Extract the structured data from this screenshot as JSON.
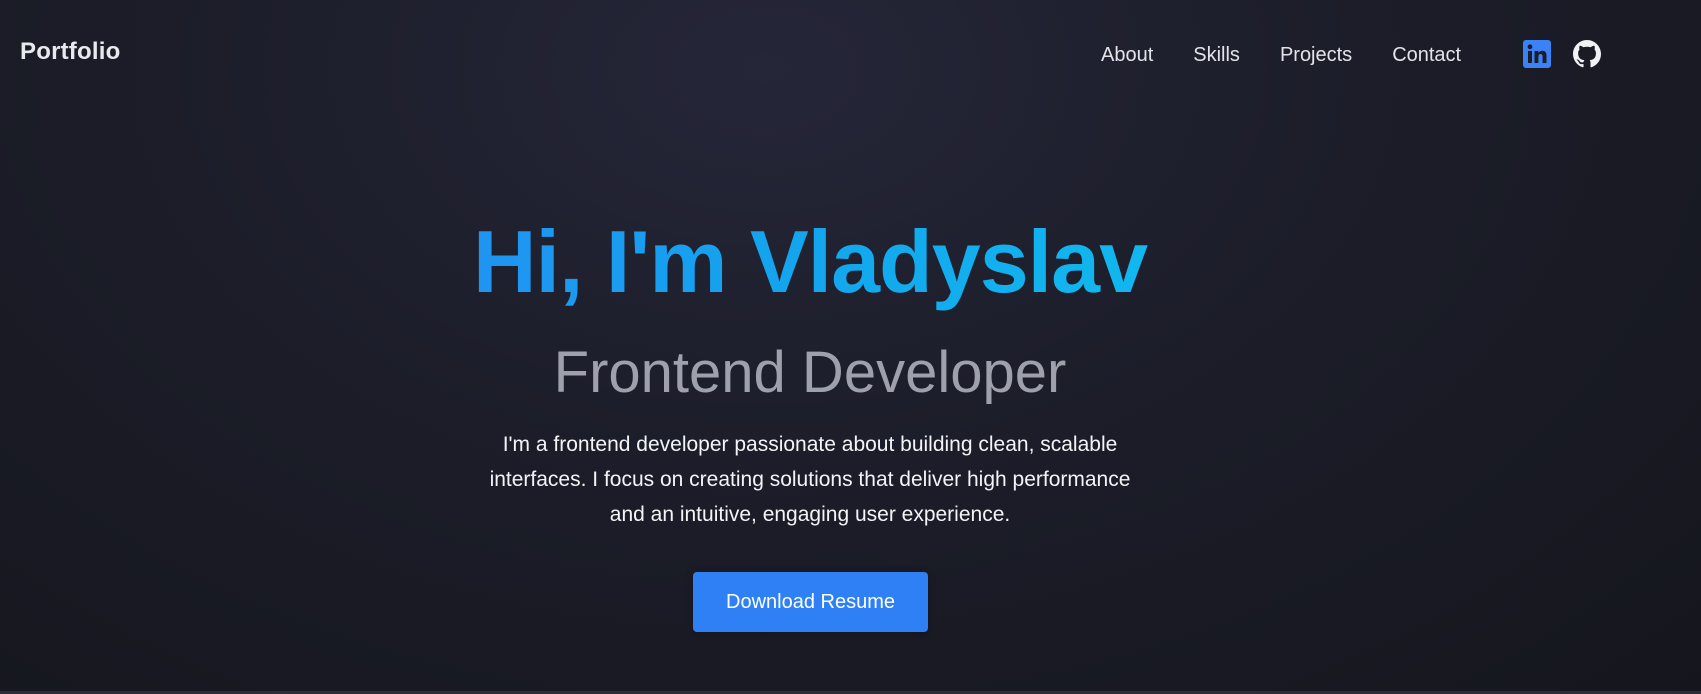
{
  "navbar": {
    "brand": "Portfolio",
    "links": [
      {
        "label": "About"
      },
      {
        "label": "Skills"
      },
      {
        "label": "Projects"
      },
      {
        "label": "Contact"
      }
    ],
    "social": [
      {
        "icon": "linkedin-icon",
        "color": "#3b82f6"
      },
      {
        "icon": "github-icon",
        "color": "#f1f2f4"
      }
    ]
  },
  "hero": {
    "title": "Hi, I'm Vladyslav",
    "subtitle": "Frontend Developer",
    "description": "I'm a frontend developer passionate about building clean, scalable interfaces. I focus on creating solutions that deliver high performance and an intuitive, engaging user experience.",
    "button_label": "Download Resume"
  },
  "colors": {
    "accent": "#2f80f5",
    "title_gradient_start": "#2f7cf6",
    "title_gradient_end": "#0fd0ef",
    "subtitle": "#9ea1ab",
    "background": "#1c1d29"
  }
}
